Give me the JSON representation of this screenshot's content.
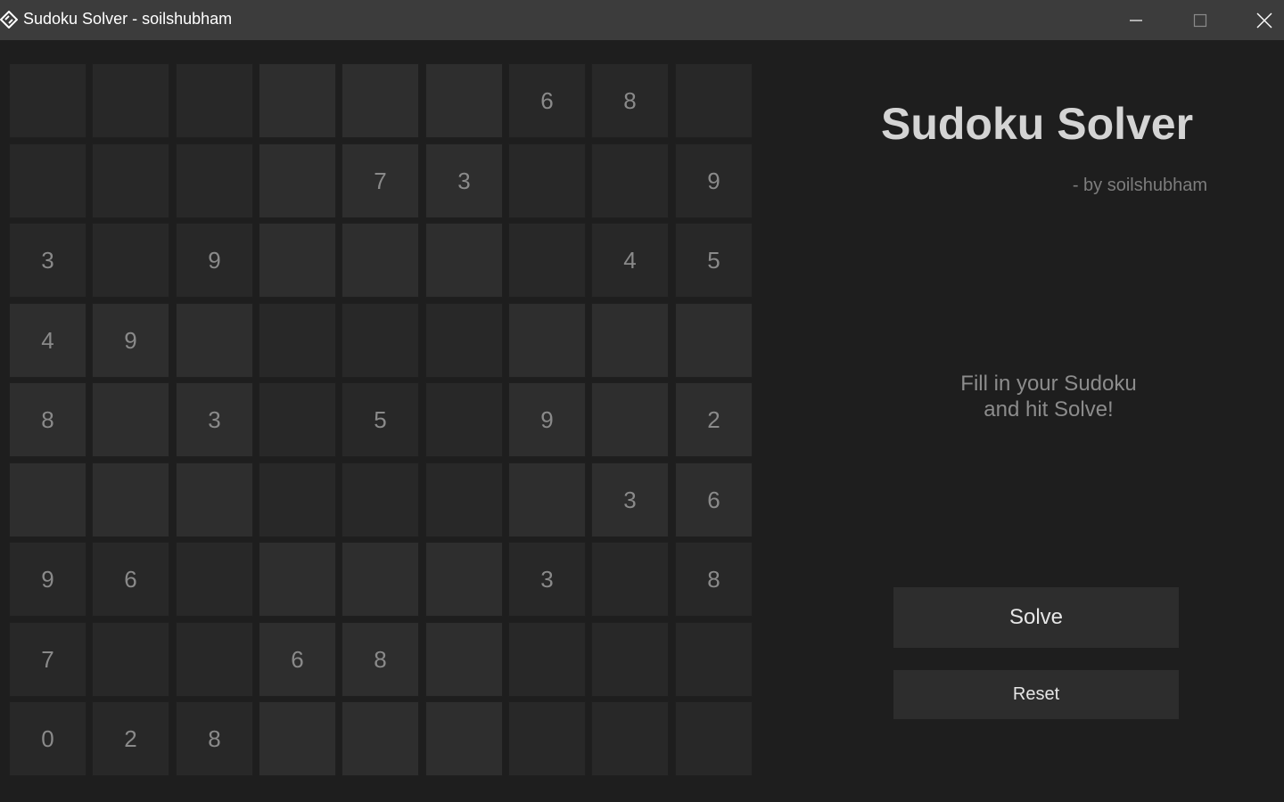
{
  "window": {
    "title": "Sudoku Solver - soilshubham"
  },
  "board": {
    "rows": [
      [
        "",
        "",
        "",
        "",
        "",
        "",
        "6",
        "8",
        ""
      ],
      [
        "",
        "",
        "",
        "",
        "7",
        "3",
        "",
        "",
        "9"
      ],
      [
        "3",
        "",
        "9",
        "",
        "",
        "",
        "",
        "4",
        "5"
      ],
      [
        "4",
        "9",
        "",
        "",
        "",
        "",
        "",
        "",
        ""
      ],
      [
        "8",
        "",
        "3",
        "",
        "5",
        "",
        "9",
        "",
        "2"
      ],
      [
        "",
        "",
        "",
        "",
        "",
        "",
        "",
        "3",
        "6"
      ],
      [
        "9",
        "6",
        "",
        "",
        "",
        "",
        "3",
        "",
        "8"
      ],
      [
        "7",
        "",
        "",
        "6",
        "8",
        "",
        "",
        "",
        ""
      ],
      [
        "0",
        "2",
        "8",
        "",
        "",
        "",
        "",
        "",
        ""
      ]
    ]
  },
  "side": {
    "title": "Sudoku Solver",
    "author": "- by soilshubham",
    "message_line1": "Fill in your Sudoku",
    "message_line2": "and hit Solve!",
    "solve_label": "Solve",
    "reset_label": "Reset"
  },
  "colors": {
    "background": "#1e1e1e",
    "titlebar": "#3c3c3c",
    "cell_light": "#2e2e2e",
    "cell_dark": "#282828",
    "button": "#2d2d2d"
  }
}
